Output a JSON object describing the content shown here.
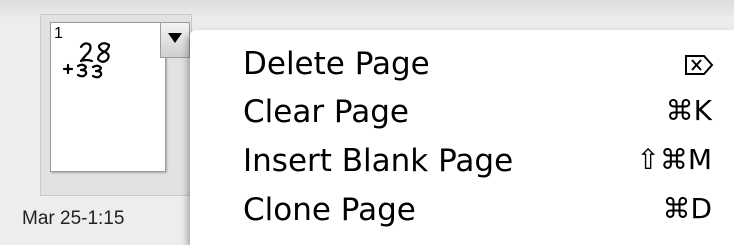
{
  "thumbnail": {
    "page_number": "1",
    "caption": "Mar 25-1:15",
    "dropdown_icon": "triangle-down-icon"
  },
  "menu": {
    "items": [
      {
        "label": "Delete Page",
        "shortcut": "",
        "shortcut_icon": "delete-forward-icon"
      },
      {
        "label": "Clear Page",
        "shortcut": "⌘K"
      },
      {
        "label": "Insert Blank Page",
        "shortcut": "⇧⌘M"
      },
      {
        "label": "Clone Page",
        "shortcut": "⌘D"
      }
    ]
  }
}
